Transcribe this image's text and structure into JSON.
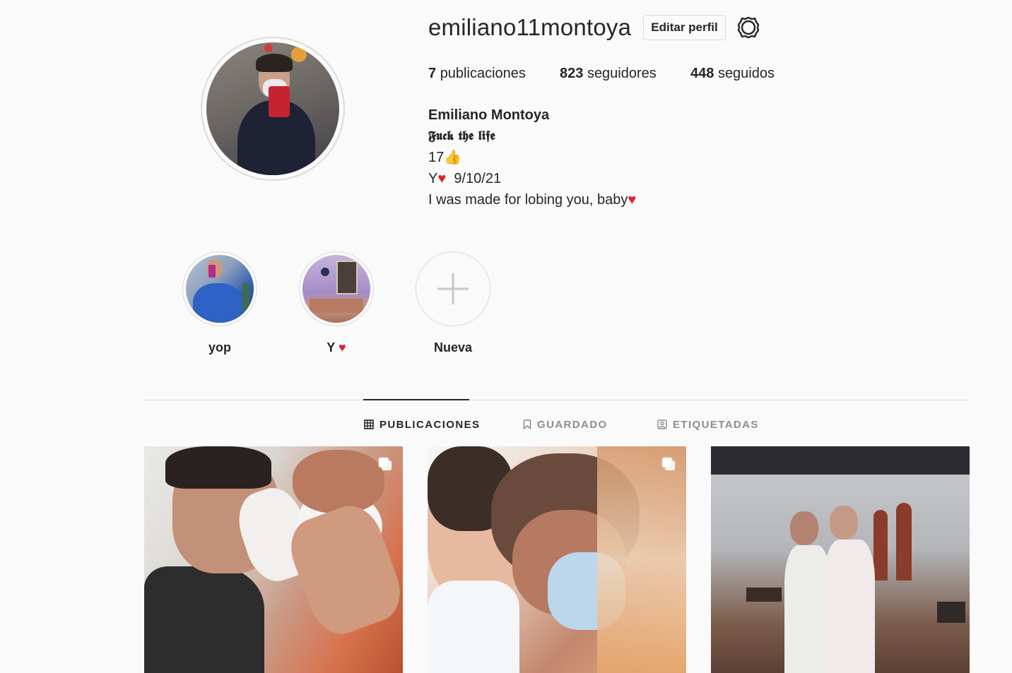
{
  "profile": {
    "username": "emiliano11montoya",
    "edit_label": "Editar perfil",
    "stats": {
      "posts_count": "7",
      "posts_label": "publicaciones",
      "followers_count": "823",
      "followers_label": "seguidores",
      "following_count": "448",
      "following_label": "seguidos"
    },
    "bio": {
      "full_name": "Emiliano Montoya",
      "line1": "𝕱𝖚𝖈𝖐 𝖙𝖍𝖊 𝖑𝖎𝖋𝖊",
      "line2": "17👍",
      "line3_prefix": "Y",
      "line3_date": "9/10/21",
      "line4": "I was made for lobing you, baby"
    }
  },
  "highlights": [
    {
      "label": "yop"
    },
    {
      "label": "Y"
    },
    {
      "label": "Nueva"
    }
  ],
  "tabs": [
    {
      "label": "PUBLICACIONES",
      "icon": "grid-icon",
      "active": true
    },
    {
      "label": "GUARDADO",
      "icon": "bookmark-icon",
      "active": false
    },
    {
      "label": "ETIQUETADAS",
      "icon": "tagged-icon",
      "active": false
    }
  ],
  "posts": [
    {
      "multi": true
    },
    {
      "multi": true
    },
    {
      "multi": false
    }
  ],
  "colors": {
    "background": "#fafafa",
    "border": "#dbdbdb",
    "text": "#262626",
    "muted": "#8e8e8e",
    "heart": "#e0212d"
  }
}
